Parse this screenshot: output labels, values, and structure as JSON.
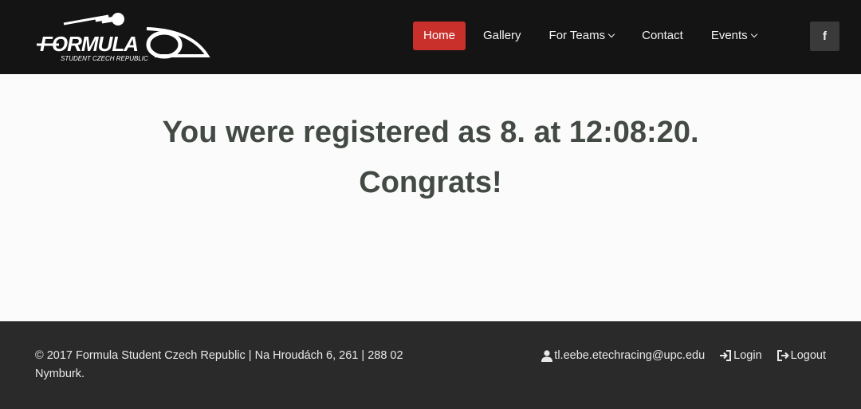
{
  "header": {
    "logo": {
      "brand": "FORMULA",
      "tagline": "STUDENT CZECH REPUBLIC"
    },
    "nav": [
      {
        "label": "Home",
        "active": true,
        "dropdown": false
      },
      {
        "label": "Gallery",
        "active": false,
        "dropdown": false
      },
      {
        "label": "For Teams",
        "active": false,
        "dropdown": true
      },
      {
        "label": "Contact",
        "active": false,
        "dropdown": false
      },
      {
        "label": "Events",
        "active": false,
        "dropdown": true
      }
    ],
    "social": {
      "icon": "facebook-icon",
      "glyph": "f"
    }
  },
  "main": {
    "line1": "You were registered as 8. at 12:08:20.",
    "line2": "Congrats!"
  },
  "footer": {
    "copyright": "© 2017 Formula Student Czech Republic | Na Hroudách 6, 261 | 288 02 Nymburk.",
    "user": "tl.eebe.etechracing@upc.edu",
    "login": "Login",
    "logout": "Logout"
  },
  "colors": {
    "navbar_bg": "#141414",
    "accent": "#c9302c",
    "footer_bg": "#2a2a2a",
    "heading_text": "#434a44"
  }
}
